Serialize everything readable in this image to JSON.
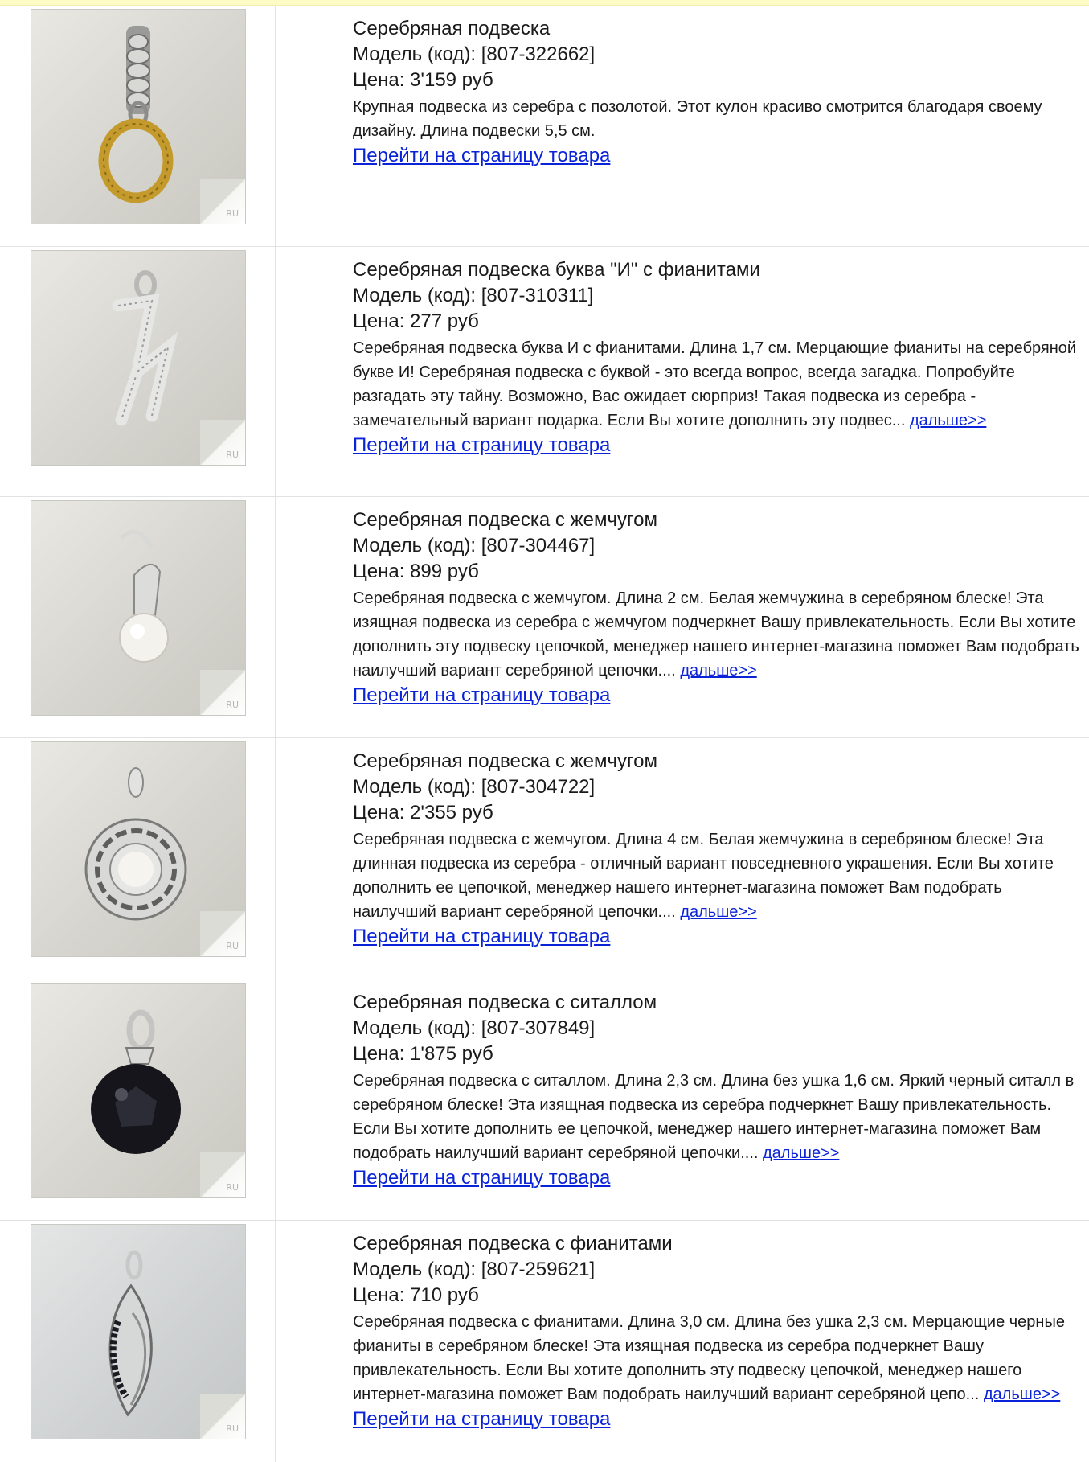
{
  "products": [
    {
      "title": "Серебряная подвеска",
      "model": "Модель (код): [807-322662]",
      "price": "Цена: 3'159 руб",
      "description": "Крупная подвеска из серебра с позолотой. Этот кулон красиво смотрится благодаря своему дизайну. Длина подвески 5,5 см.",
      "more_label": "",
      "link_label": "Перейти на страницу товара",
      "watermark": "RU"
    },
    {
      "title": "Серебряная подвеска буква \"И\" с фианитами",
      "model": "Модель (код): [807-310311]",
      "price": "Цена: 277 руб",
      "description": "Серебряная подвеска буква И с фианитами. Длина 1,7 см. Мерцающие фианиты на серебряной букве И! Серебряная подвеска с буквой - это всегда вопрос, всегда загадка. Попробуйте разгадать эту тайну. Возможно, Вас ожидает сюрприз! Такая подвеска из серебра - замечательный вариант подарка. Если Вы хотите дополнить эту подвес...",
      "more_label": "дальше>>",
      "link_label": "Перейти на страницу товара",
      "watermark": "RU"
    },
    {
      "title": "Серебряная подвеска с жемчугом",
      "model": "Модель (код): [807-304467]",
      "price": "Цена: 899 руб",
      "description": "Серебряная подвеска с жемчугом. Длина 2 см. Белая жемчужина в серебряном блеске! Эта изящная подвеска из серебра с жемчугом подчеркнет Вашу привлекательность. Если Вы хотите дополнить эту подвеску цепочкой, менеджер нашего интернет-магазина поможет Вам подобрать наилучший вариант серебряной цепочки....",
      "more_label": "дальше>>",
      "link_label": "Перейти на страницу товара",
      "watermark": "RU"
    },
    {
      "title": "Серебряная подвеска с жемчугом",
      "model": "Модель (код): [807-304722]",
      "price": "Цена: 2'355 руб",
      "description": "Серебряная подвеска с жемчугом. Длина 4 см. Белая жемчужина в серебряном блеске! Эта длинная подвеска из серебра - отличный вариант повседневного украшения. Если Вы хотите дополнить ее цепочкой, менеджер нашего интернет-магазина поможет Вам подобрать наилучший вариант серебряной цепочки....",
      "more_label": "дальше>>",
      "link_label": "Перейти на страницу товара",
      "watermark": "RU"
    },
    {
      "title": "Серебряная подвеска с ситаллом",
      "model": "Модель (код): [807-307849]",
      "price": "Цена: 1'875 руб",
      "description": "Серебряная подвеска с ситаллом. Длина 2,3 см. Длина без ушка 1,6 см. Яркий черный ситалл в серебряном блеске! Эта изящная подвеска из серебра подчеркнет Вашу привлекательность. Если Вы хотите дополнить ее цепочкой, менеджер нашего интернет-магазина поможет Вам подобрать наилучший вариант серебряной цепочки....",
      "more_label": "дальше>>",
      "link_label": "Перейти на страницу товара",
      "watermark": "RU"
    },
    {
      "title": "Серебряная подвеска с фианитами",
      "model": "Модель (код): [807-259621]",
      "price": "Цена: 710 руб",
      "description": "Серебряная подвеска с фианитами. Длина 3,0 см. Длина без ушка 2,3 см. Мерцающие черные фианиты в серебряном блеске! Эта изящная подвеска из серебра подчеркнет Вашу привлекательность. Если Вы хотите дополнить эту подвеску цепочкой, менеджер нашего интернет-магазина поможет Вам подобрать наилучший вариант серебряной цепо...",
      "more_label": "дальше>>",
      "link_label": "Перейти на страницу товара",
      "watermark": "RU"
    }
  ]
}
